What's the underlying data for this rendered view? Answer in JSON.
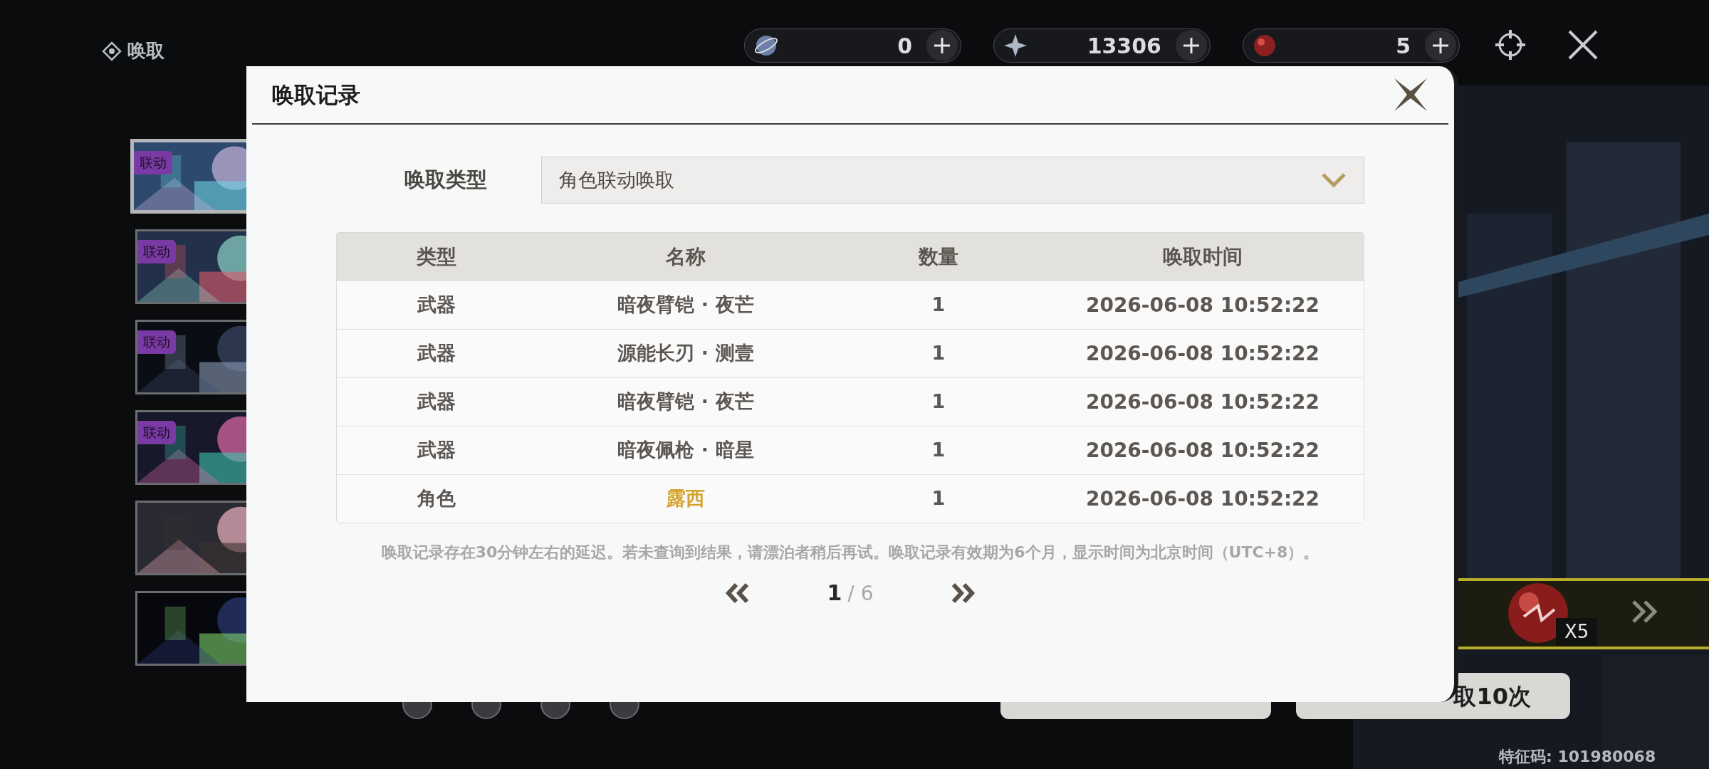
{
  "hud": {
    "title": "唤取",
    "currencies": [
      {
        "amount": "0"
      },
      {
        "amount": "13306"
      },
      {
        "amount": "5"
      }
    ]
  },
  "banners": [
    {
      "badge": "联动",
      "selected": true
    },
    {
      "badge": "联动",
      "selected": false
    },
    {
      "badge": "联动",
      "selected": false
    },
    {
      "badge": "联动",
      "selected": false
    },
    {
      "selected": false
    },
    {
      "selected": false
    }
  ],
  "promo": {
    "multiplier": "X5"
  },
  "pull_button": {
    "label": "取10次"
  },
  "feature_code": "特征码: 101980068",
  "dialog": {
    "title": "唤取记录",
    "filter": {
      "label": "唤取类型",
      "value": "角色联动唤取"
    },
    "table": {
      "columns": [
        "类型",
        "名称",
        "数量",
        "唤取时间"
      ],
      "rows": [
        {
          "type": "武器",
          "name": "暗夜臂铠 · 夜芒",
          "count": "1",
          "time": "2026-06-08 10:52:22",
          "color": "#5c5752"
        },
        {
          "type": "武器",
          "name": "源能长刃 · 测壹",
          "count": "1",
          "time": "2026-06-08 10:52:22",
          "color": "#5c5752"
        },
        {
          "type": "武器",
          "name": "暗夜臂铠 · 夜芒",
          "count": "1",
          "time": "2026-06-08 10:52:22",
          "color": "#5c5752"
        },
        {
          "type": "武器",
          "name": "暗夜佩枪 · 暗星",
          "count": "1",
          "time": "2026-06-08 10:52:22",
          "color": "#5c5752"
        },
        {
          "type": "角色",
          "name": "露西",
          "count": "1",
          "time": "2026-06-08 10:52:22",
          "color": "#d4a430"
        }
      ]
    },
    "note": "唤取记录存在30分钟左右的延迟。若未查询到结果，请漂泊者稍后再试。唤取记录有效期为6个月，显示时间为北京时间（UTC+8）。",
    "pagination": {
      "current": "1",
      "total": "/ 6"
    }
  }
}
